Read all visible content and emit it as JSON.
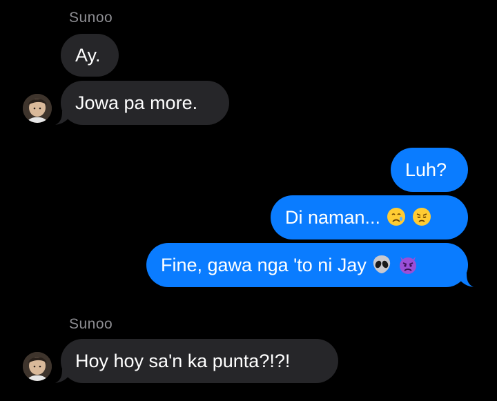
{
  "thread": {
    "groups": [
      {
        "sender": "Sunoo",
        "messages": [
          "Ay.",
          "Jowa pa more."
        ]
      },
      {
        "sender": "me",
        "messages": [
          "Luh?",
          "Di naman...",
          "Fine, gawa nga 'to ni Jay"
        ]
      },
      {
        "sender": "Sunoo",
        "messages": [
          "Hoy hoy sa'n ka punta?!?!"
        ]
      }
    ]
  },
  "emojis": {
    "msg_2": [
      "crying-face-icon",
      "disappointed-face-icon"
    ],
    "msg_3": [
      "alien-icon",
      "angry-devil-icon"
    ]
  },
  "colors": {
    "background": "#000000",
    "incoming_bubble": "#262629",
    "outgoing_bubble": "#0a7cff",
    "sender_name": "#8e8e93"
  }
}
